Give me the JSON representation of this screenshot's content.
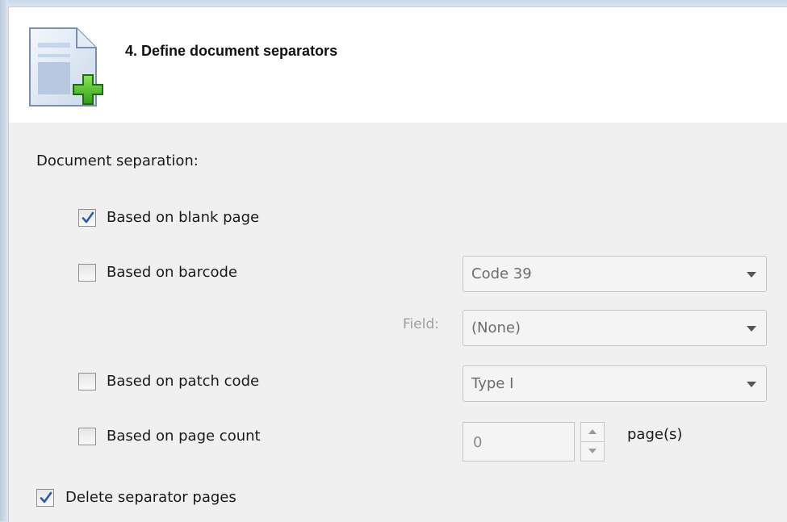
{
  "header": {
    "title": "4. Define document separators",
    "icon": "document-add-icon"
  },
  "separation": {
    "section_label": "Document separation:",
    "blank_page": {
      "label": "Based on blank page",
      "checked": true
    },
    "barcode": {
      "label": "Based on barcode",
      "checked": false,
      "type_value": "Code 39"
    },
    "field": {
      "label": "Field:",
      "value": "(None)"
    },
    "patch_code": {
      "label": "Based on patch code",
      "checked": false,
      "value": "Type I"
    },
    "page_count": {
      "label": "Based on page count",
      "checked": false,
      "value": "0",
      "unit": "page(s)"
    },
    "delete_pages": {
      "label": "Delete separator pages",
      "checked": true
    }
  },
  "colors": {
    "header_bg": "#ffffff",
    "body_bg": "#f0f0f0",
    "check_color": "#2a5ca8",
    "plus_green": "#4dbd26"
  }
}
